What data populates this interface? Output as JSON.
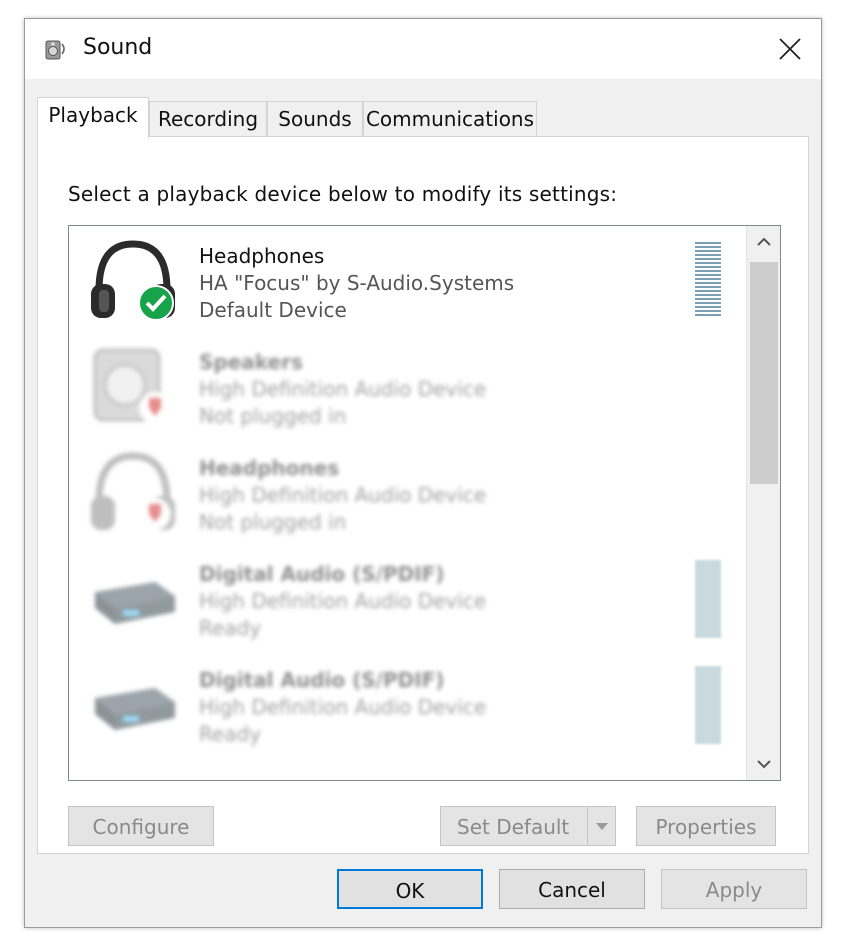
{
  "window": {
    "title": "Sound"
  },
  "tabs": [
    {
      "label": "Playback",
      "active": true
    },
    {
      "label": "Recording",
      "active": false
    },
    {
      "label": "Sounds",
      "active": false
    },
    {
      "label": "Communications",
      "active": false
    }
  ],
  "instruction": "Select a playback device below to modify its settings:",
  "devices": [
    {
      "name": "Headphones",
      "description": "HA \"Focus\" by S-Audio.Systems",
      "status": "Default Device",
      "icon": "headphones-icon",
      "badge": "default-check-icon",
      "blurred": false
    },
    {
      "name": "Speakers",
      "description": "High Definition Audio Device",
      "status": "Not plugged in",
      "icon": "speaker-icon",
      "badge": "unplugged-icon",
      "blurred": true
    },
    {
      "name": "Headphones",
      "description": "High Definition Audio Device",
      "status": "Not plugged in",
      "icon": "headphones-icon",
      "badge": "unplugged-icon",
      "blurred": true
    },
    {
      "name": "Digital Audio (S/PDIF)",
      "description": "High Definition Audio Device",
      "status": "Ready",
      "icon": "digital-audio-icon",
      "blurred": true
    },
    {
      "name": "Digital Audio (S/PDIF)",
      "description": "High Definition Audio Device",
      "status": "Ready",
      "icon": "digital-audio-icon",
      "blurred": true
    }
  ],
  "buttons": {
    "configure": "Configure",
    "set_default": "Set Default",
    "properties": "Properties",
    "ok": "OK",
    "cancel": "Cancel",
    "apply": "Apply"
  },
  "colors": {
    "accent": "#0078d7",
    "check_green": "#16a34a",
    "unplugged_red": "#d32f2f"
  }
}
